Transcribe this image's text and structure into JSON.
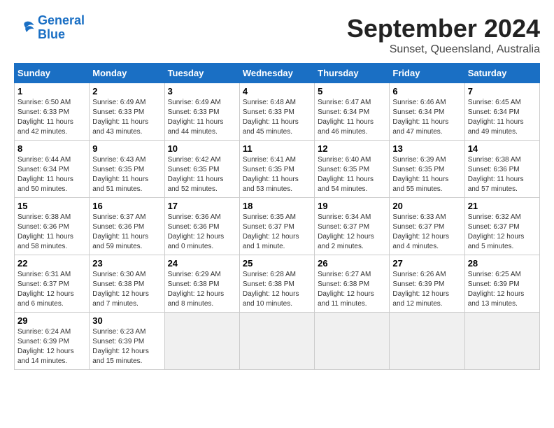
{
  "header": {
    "logo_line1": "General",
    "logo_line2": "Blue",
    "main_title": "September 2024",
    "sub_title": "Sunset, Queensland, Australia"
  },
  "calendar": {
    "days_of_week": [
      "Sunday",
      "Monday",
      "Tuesday",
      "Wednesday",
      "Thursday",
      "Friday",
      "Saturday"
    ],
    "weeks": [
      [
        {
          "day": "",
          "empty": true
        },
        {
          "day": "",
          "empty": true
        },
        {
          "day": "",
          "empty": true
        },
        {
          "day": "",
          "empty": true
        },
        {
          "day": "",
          "empty": true
        },
        {
          "day": "",
          "empty": true
        },
        {
          "day": "",
          "empty": true
        }
      ],
      [
        {
          "num": "1",
          "sunrise": "6:50 AM",
          "sunset": "6:33 PM",
          "daylight": "11 hours and 42 minutes."
        },
        {
          "num": "2",
          "sunrise": "6:49 AM",
          "sunset": "6:33 PM",
          "daylight": "11 hours and 43 minutes."
        },
        {
          "num": "3",
          "sunrise": "6:49 AM",
          "sunset": "6:33 PM",
          "daylight": "11 hours and 44 minutes."
        },
        {
          "num": "4",
          "sunrise": "6:48 AM",
          "sunset": "6:33 PM",
          "daylight": "11 hours and 45 minutes."
        },
        {
          "num": "5",
          "sunrise": "6:47 AM",
          "sunset": "6:34 PM",
          "daylight": "11 hours and 46 minutes."
        },
        {
          "num": "6",
          "sunrise": "6:46 AM",
          "sunset": "6:34 PM",
          "daylight": "11 hours and 47 minutes."
        },
        {
          "num": "7",
          "sunrise": "6:45 AM",
          "sunset": "6:34 PM",
          "daylight": "11 hours and 49 minutes."
        }
      ],
      [
        {
          "num": "8",
          "sunrise": "6:44 AM",
          "sunset": "6:34 PM",
          "daylight": "11 hours and 50 minutes."
        },
        {
          "num": "9",
          "sunrise": "6:43 AM",
          "sunset": "6:35 PM",
          "daylight": "11 hours and 51 minutes."
        },
        {
          "num": "10",
          "sunrise": "6:42 AM",
          "sunset": "6:35 PM",
          "daylight": "11 hours and 52 minutes."
        },
        {
          "num": "11",
          "sunrise": "6:41 AM",
          "sunset": "6:35 PM",
          "daylight": "11 hours and 53 minutes."
        },
        {
          "num": "12",
          "sunrise": "6:40 AM",
          "sunset": "6:35 PM",
          "daylight": "11 hours and 54 minutes."
        },
        {
          "num": "13",
          "sunrise": "6:39 AM",
          "sunset": "6:35 PM",
          "daylight": "11 hours and 55 minutes."
        },
        {
          "num": "14",
          "sunrise": "6:38 AM",
          "sunset": "6:36 PM",
          "daylight": "11 hours and 57 minutes."
        }
      ],
      [
        {
          "num": "15",
          "sunrise": "6:38 AM",
          "sunset": "6:36 PM",
          "daylight": "11 hours and 58 minutes."
        },
        {
          "num": "16",
          "sunrise": "6:37 AM",
          "sunset": "6:36 PM",
          "daylight": "11 hours and 59 minutes."
        },
        {
          "num": "17",
          "sunrise": "6:36 AM",
          "sunset": "6:36 PM",
          "daylight": "12 hours and 0 minutes."
        },
        {
          "num": "18",
          "sunrise": "6:35 AM",
          "sunset": "6:37 PM",
          "daylight": "12 hours and 1 minute."
        },
        {
          "num": "19",
          "sunrise": "6:34 AM",
          "sunset": "6:37 PM",
          "daylight": "12 hours and 2 minutes."
        },
        {
          "num": "20",
          "sunrise": "6:33 AM",
          "sunset": "6:37 PM",
          "daylight": "12 hours and 4 minutes."
        },
        {
          "num": "21",
          "sunrise": "6:32 AM",
          "sunset": "6:37 PM",
          "daylight": "12 hours and 5 minutes."
        }
      ],
      [
        {
          "num": "22",
          "sunrise": "6:31 AM",
          "sunset": "6:37 PM",
          "daylight": "12 hours and 6 minutes."
        },
        {
          "num": "23",
          "sunrise": "6:30 AM",
          "sunset": "6:38 PM",
          "daylight": "12 hours and 7 minutes."
        },
        {
          "num": "24",
          "sunrise": "6:29 AM",
          "sunset": "6:38 PM",
          "daylight": "12 hours and 8 minutes."
        },
        {
          "num": "25",
          "sunrise": "6:28 AM",
          "sunset": "6:38 PM",
          "daylight": "12 hours and 10 minutes."
        },
        {
          "num": "26",
          "sunrise": "6:27 AM",
          "sunset": "6:38 PM",
          "daylight": "12 hours and 11 minutes."
        },
        {
          "num": "27",
          "sunrise": "6:26 AM",
          "sunset": "6:39 PM",
          "daylight": "12 hours and 12 minutes."
        },
        {
          "num": "28",
          "sunrise": "6:25 AM",
          "sunset": "6:39 PM",
          "daylight": "12 hours and 13 minutes."
        }
      ],
      [
        {
          "num": "29",
          "sunrise": "6:24 AM",
          "sunset": "6:39 PM",
          "daylight": "12 hours and 14 minutes."
        },
        {
          "num": "30",
          "sunrise": "6:23 AM",
          "sunset": "6:39 PM",
          "daylight": "12 hours and 15 minutes."
        },
        {
          "day": "",
          "empty": true
        },
        {
          "day": "",
          "empty": true
        },
        {
          "day": "",
          "empty": true
        },
        {
          "day": "",
          "empty": true
        },
        {
          "day": "",
          "empty": true
        }
      ]
    ]
  }
}
